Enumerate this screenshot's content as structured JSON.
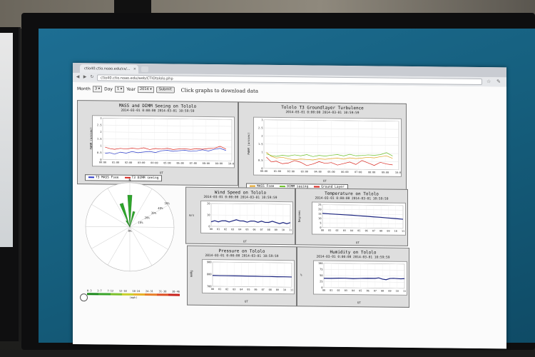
{
  "browser": {
    "tab_title": "ctio40.ctio.noao.edu/cs/...",
    "tab_close": "×",
    "url": "ctio40.ctio.noao.edu/web/CTIOtololo.php"
  },
  "controls": {
    "month_label": "Month",
    "month_value": "3",
    "day_label": "Day",
    "day_value": "1",
    "year_label": "Year",
    "year_value": "2014",
    "submit_label": "Submit",
    "click_text": "Click graphs to download data"
  },
  "panels": {
    "seeing": {
      "title": "MASS and DIMM Seeing on Tololo",
      "subtitle": "2014-03-01 0:00:00 2014-03-01 10:59:59",
      "ylabel": "FWHM (arcsec)",
      "xlabel": "UT",
      "legend": [
        "T3 MASS Fsee",
        "T3 DIMM seeing"
      ]
    },
    "turbulence": {
      "title": "Tololo T3 Groundlayer Turbulence",
      "subtitle": "2014-03-01 0:00:00 2014-03-01 10:59:59",
      "ylabel": "FWHM (arcsec)",
      "xlabel": "UT",
      "legend": [
        "MASS Fsee",
        "DIMM seeing",
        "Ground Layer"
      ]
    },
    "wind": {
      "title": "Wind Speed on Tololo",
      "subtitle": "2014-03-01 0:00:00 2014-03-01 10:59:59",
      "ylabel": "m/s",
      "xlabel": "UT"
    },
    "temperature": {
      "title": "Temperature on Tololo",
      "subtitle": "2014-03-01 0:00:00 2014-03-01 10:59:59",
      "ylabel": "Degrees",
      "xlabel": "UT"
    },
    "pressure": {
      "title": "Pressure on Tololo",
      "subtitle": "2014-03-01 0:00:00 2014-03-01 10:59:59",
      "ylabel": "mmHg",
      "xlabel": "UT"
    },
    "humidity": {
      "title": "Humidity on Tololo",
      "subtitle": "2014-03-01 0:00:00 2014-03-01 10:59:59",
      "ylabel": "%",
      "xlabel": "UT"
    }
  },
  "windrose": {
    "north_label": "N",
    "center_label": "0%",
    "ring_labels": [
      "10%",
      "20%",
      "30%",
      "40%",
      "50%"
    ],
    "colorbar_labels": [
      "0-3",
      "3-7",
      "7-12",
      "12-18",
      "18-24",
      "24-31",
      "31-38",
      "38-46"
    ],
    "colorbar_colors": [
      "#1e8a1e",
      "#3aa52b",
      "#7cc02c",
      "#c8cf2a",
      "#e8b12a",
      "#e8802a",
      "#dd4f24",
      "#c8221c"
    ],
    "units": "(mph)"
  },
  "chart_data": [
    {
      "type": "line",
      "title": "MASS and DIMM Seeing on Tololo",
      "subtitle": "2014-03-01 0:00:00 2014-03-01 10:59:59",
      "xlabel": "UT",
      "ylabel": "FWHM (arcsec)",
      "ylim": [
        0,
        3.0
      ],
      "yticks": [
        0,
        0.5,
        1.0,
        1.5,
        2.0,
        2.5,
        3.0
      ],
      "xticks": [
        "00:00",
        "01:00",
        "02:00",
        "03:00",
        "04:00",
        "05:00",
        "06:00",
        "07:00",
        "08:00",
        "09:00",
        "10:00"
      ],
      "xlim": [
        0,
        11
      ],
      "series": [
        {
          "name": "T3 MASS Fsee",
          "color": "#2b3cc9",
          "x": [
            0.2,
            0.6,
            1.0,
            1.5,
            2.0,
            2.5,
            3.0,
            3.5,
            4.0,
            4.5,
            5.0,
            5.5,
            6.0,
            6.5,
            7.0,
            7.5,
            8.0,
            8.5,
            9.0,
            9.5,
            10.0,
            10.5
          ],
          "y": [
            0.45,
            0.5,
            0.4,
            0.55,
            0.48,
            0.6,
            0.52,
            0.58,
            0.62,
            0.55,
            0.68,
            0.72,
            0.65,
            0.7,
            0.74,
            0.66,
            0.7,
            0.78,
            0.7,
            0.82,
            0.9,
            0.75
          ]
        },
        {
          "name": "T3 DIMM seeing",
          "color": "#d8231c",
          "x": [
            0.2,
            0.6,
            1.0,
            1.5,
            2.0,
            2.5,
            3.0,
            3.5,
            4.0,
            4.5,
            5.0,
            5.5,
            6.0,
            6.5,
            7.0,
            7.5,
            8.0,
            8.5,
            9.0,
            9.5,
            10.0,
            10.5
          ],
          "y": [
            0.9,
            0.8,
            0.75,
            0.82,
            0.78,
            0.85,
            0.8,
            0.88,
            0.76,
            0.84,
            0.8,
            0.86,
            0.78,
            0.82,
            0.84,
            0.8,
            0.86,
            0.82,
            0.88,
            0.9,
            1.05,
            0.85
          ]
        }
      ]
    },
    {
      "type": "line",
      "title": "Tololo T3 Groundlayer Turbulence",
      "subtitle": "2014-03-01 0:00:00 2014-03-01 10:59:59",
      "xlabel": "UT",
      "ylabel": "FWHM (arcsec)",
      "ylim": [
        0,
        3.0
      ],
      "yticks": [
        0,
        0.5,
        1.0,
        1.5,
        2.0,
        2.5,
        3.0
      ],
      "xticks": [
        "00:00",
        "01:00",
        "02:00",
        "03:00",
        "04:00",
        "05:00",
        "06:00",
        "07:00",
        "08:00",
        "09:00",
        "10:00"
      ],
      "xlim": [
        0,
        11
      ],
      "series": [
        {
          "name": "MASS Fsee",
          "color": "#e0a020",
          "x": [
            0.2,
            0.6,
            1.0,
            1.5,
            2.0,
            2.5,
            3.0,
            3.5,
            4.0,
            4.5,
            5.0,
            5.5,
            6.0,
            6.5,
            7.0,
            7.5,
            8.0,
            8.5,
            9.0,
            9.5,
            10.0,
            10.5
          ],
          "y": [
            1.0,
            0.75,
            0.65,
            0.7,
            0.6,
            0.55,
            0.6,
            0.58,
            0.55,
            0.62,
            0.6,
            0.65,
            0.68,
            0.62,
            0.7,
            0.66,
            0.7,
            0.75,
            0.72,
            0.8,
            0.85,
            0.7
          ]
        },
        {
          "name": "DIMM seeing",
          "color": "#6cc02a",
          "x": [
            0.2,
            0.6,
            1.0,
            1.5,
            2.0,
            2.5,
            3.0,
            3.5,
            4.0,
            4.5,
            5.0,
            5.5,
            6.0,
            6.5,
            7.0,
            7.5,
            8.0,
            8.5,
            9.0,
            9.5,
            10.0,
            10.5
          ],
          "y": [
            0.9,
            0.8,
            0.75,
            0.82,
            0.78,
            0.85,
            0.8,
            0.88,
            0.76,
            0.84,
            0.8,
            0.86,
            0.9,
            0.82,
            0.92,
            0.84,
            0.86,
            0.9,
            0.88,
            0.92,
            1.05,
            0.85
          ]
        },
        {
          "name": "Ground Layer",
          "color": "#d8231c",
          "x": [
            0.2,
            0.6,
            1.0,
            1.5,
            2.0,
            2.5,
            3.0,
            3.5,
            4.0,
            4.5,
            5.0,
            5.5,
            6.0,
            6.5,
            7.0,
            7.5,
            8.0,
            8.5,
            9.0,
            9.5,
            10.0,
            10.5
          ],
          "y": [
            0.7,
            0.4,
            0.45,
            0.3,
            0.35,
            0.5,
            0.4,
            0.2,
            0.3,
            0.45,
            0.35,
            0.4,
            0.25,
            0.35,
            0.45,
            0.3,
            0.55,
            0.4,
            0.25,
            0.45,
            0.35,
            0.3
          ]
        }
      ]
    },
    {
      "type": "line",
      "title": "Wind Speed on Tololo",
      "subtitle": "2014-03-01 0:00:00 2014-03-01 10:59:59",
      "xlabel": "UT",
      "ylabel": "m/s",
      "ylim": [
        0,
        20
      ],
      "yticks": [
        0,
        10,
        20
      ],
      "xticks": [
        "00",
        "01",
        "02",
        "03",
        "04",
        "05",
        "06",
        "07",
        "08",
        "09",
        "10",
        "11"
      ],
      "xlim": [
        0,
        11
      ],
      "series": [
        {
          "name": "",
          "color": "#1a237e",
          "x": [
            0,
            0.5,
            1,
            1.5,
            2,
            2.5,
            3,
            3.5,
            4,
            4.5,
            5,
            5.5,
            6,
            6.5,
            7,
            7.5,
            8,
            8.5,
            9,
            9.5,
            10,
            10.5,
            11
          ],
          "y": [
            4,
            5,
            4,
            5,
            5,
            4,
            5,
            6,
            5,
            5,
            4,
            5,
            5,
            4,
            5,
            4,
            4,
            5,
            4,
            3,
            4,
            3,
            4
          ]
        }
      ]
    },
    {
      "type": "line",
      "title": "Temperature on Tololo",
      "subtitle": "2014-03-01 0:00:00 2014-03-01 10:59:59",
      "xlabel": "UT",
      "ylabel": "Degrees",
      "ylim": [
        0,
        25
      ],
      "yticks": [
        0,
        5,
        10,
        15,
        20,
        25
      ],
      "xticks": [
        "00",
        "01",
        "02",
        "03",
        "04",
        "05",
        "06",
        "07",
        "08",
        "09",
        "10",
        "11"
      ],
      "xlim": [
        0,
        11
      ],
      "series": [
        {
          "name": "",
          "color": "#1a237e",
          "x": [
            0,
            1,
            2,
            3,
            4,
            5,
            6,
            7,
            8,
            9,
            10,
            11
          ],
          "y": [
            15.5,
            15,
            14.6,
            14.2,
            13.8,
            13.3,
            12.8,
            12.3,
            11.8,
            11.2,
            10.6,
            10
          ]
        }
      ]
    },
    {
      "type": "line",
      "title": "Pressure on Tololo",
      "subtitle": "2014-03-01 0:00:00 2014-03-01 10:59:59",
      "xlabel": "UT",
      "ylabel": "mmHg",
      "ylim": [
        700,
        900
      ],
      "yticks": [
        700,
        800,
        900
      ],
      "xticks": [
        "00",
        "01",
        "02",
        "03",
        "04",
        "05",
        "06",
        "07",
        "08",
        "09",
        "10",
        "11"
      ],
      "xlim": [
        0,
        11
      ],
      "series": [
        {
          "name": "",
          "color": "#1a237e",
          "x": [
            0,
            1,
            2,
            3,
            4,
            5,
            6,
            7,
            8,
            9,
            10,
            11
          ],
          "y": [
            790,
            789,
            789,
            788,
            788,
            787,
            787,
            786,
            786,
            785,
            785,
            784
          ]
        }
      ]
    },
    {
      "type": "line",
      "title": "Humidity on Tololo",
      "subtitle": "2014-03-01 0:00:00 2014-03-01 10:59:59",
      "xlabel": "UT",
      "ylabel": "%",
      "ylim": [
        0,
        100
      ],
      "yticks": [
        0,
        25,
        50,
        75,
        100
      ],
      "xticks": [
        "00",
        "01",
        "02",
        "03",
        "04",
        "05",
        "06",
        "07",
        "08",
        "09",
        "10",
        "11"
      ],
      "xlim": [
        0,
        11
      ],
      "series": [
        {
          "name": "",
          "color": "#1a237e",
          "x": [
            0,
            1,
            2,
            3,
            4,
            5,
            6,
            7,
            7.5,
            8,
            8.5,
            9,
            9.5,
            10,
            10.5,
            11
          ],
          "y": [
            38,
            38,
            39,
            39,
            38,
            39,
            40,
            40,
            42,
            37,
            35,
            40,
            41,
            40,
            39,
            40
          ]
        }
      ]
    },
    {
      "type": "wind-rose",
      "north_label": "N",
      "ring_labels": [
        "10%",
        "20%",
        "30%",
        "40%",
        "50%"
      ],
      "units": "(mph)",
      "petals": [
        {
          "direction_deg": -20,
          "percent": 28,
          "color": "#2ea52b"
        },
        {
          "direction_deg": 0,
          "percent": 36,
          "color": "#2ea52b"
        },
        {
          "direction_deg": 15,
          "percent": 18,
          "color": "#2ea52b"
        },
        {
          "direction_deg": -30,
          "percent": 8,
          "color": "#2ea52b"
        }
      ]
    }
  ]
}
